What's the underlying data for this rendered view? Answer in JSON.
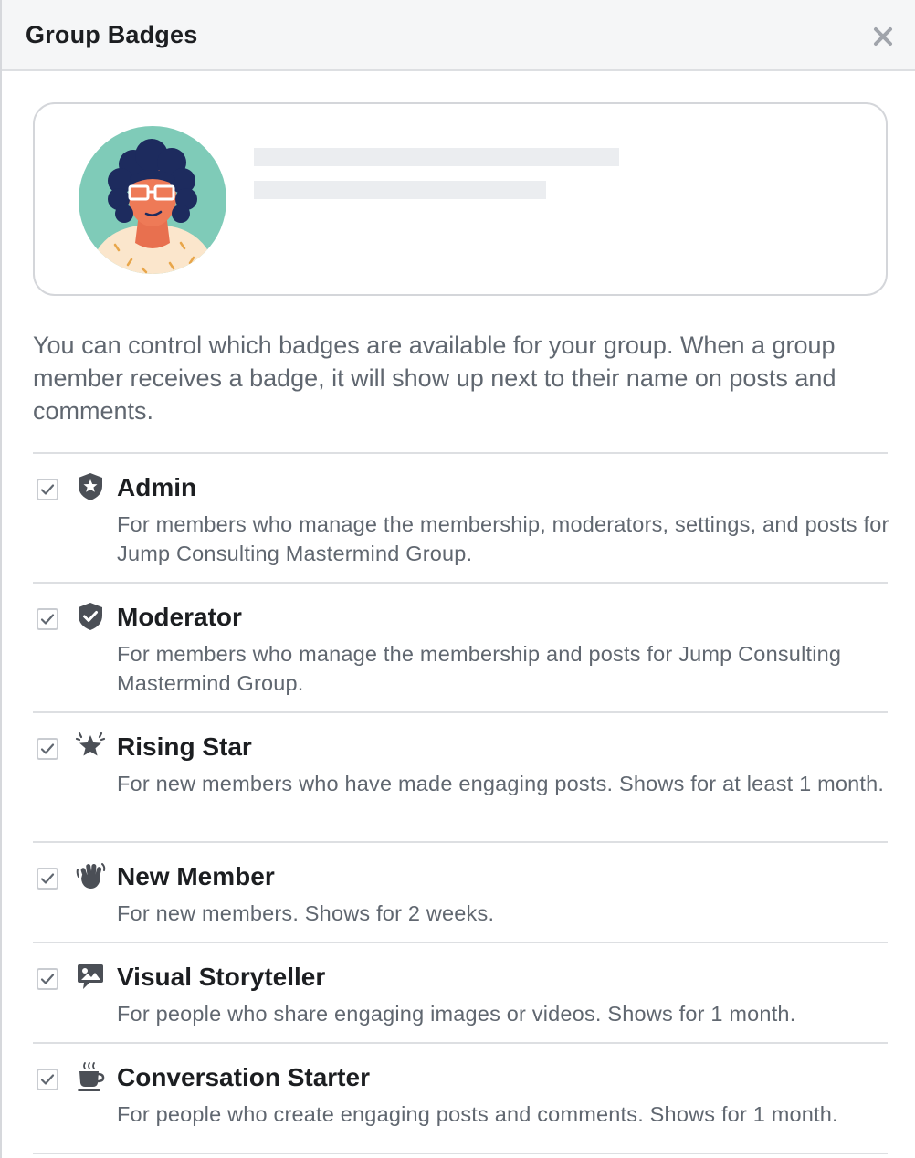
{
  "dialog": {
    "title": "Group Badges"
  },
  "description": "You can control which badges are available for your group. When a group member receives a badge, it will show up next to their name on posts and comments.",
  "badges": [
    {
      "title": "Admin",
      "description": "For members who manage the membership, moderators, settings, and posts for Jump Consulting Mastermind Group.",
      "icon": "shield-star-icon",
      "checked": true
    },
    {
      "title": "Moderator",
      "description": "For members who manage the membership and posts for Jump Consulting Mastermind Group.",
      "icon": "shield-check-icon",
      "checked": true
    },
    {
      "title": "Rising Star",
      "description": "For new members who have made engaging posts. Shows for at least 1 month.",
      "icon": "rising-star-icon",
      "checked": true
    },
    {
      "title": "New Member",
      "description": "For new members. Shows for 2 weeks.",
      "icon": "waving-hand-icon",
      "checked": true
    },
    {
      "title": "Visual Storyteller",
      "description": "For people who share engaging images or videos. Shows for 1 month.",
      "icon": "photo-icon",
      "checked": true
    },
    {
      "title": "Conversation Starter",
      "description": "For people who create engaging posts and comments. Shows for 1 month.",
      "icon": "coffee-cup-icon",
      "checked": true
    }
  ],
  "colors": {
    "title_text": "#1c1e21",
    "secondary_text": "#606770",
    "icon": "#4b4f56",
    "divider": "#dddfe2",
    "header_bg": "#f5f6f7",
    "avatar_bg": "#7fcbb8"
  }
}
